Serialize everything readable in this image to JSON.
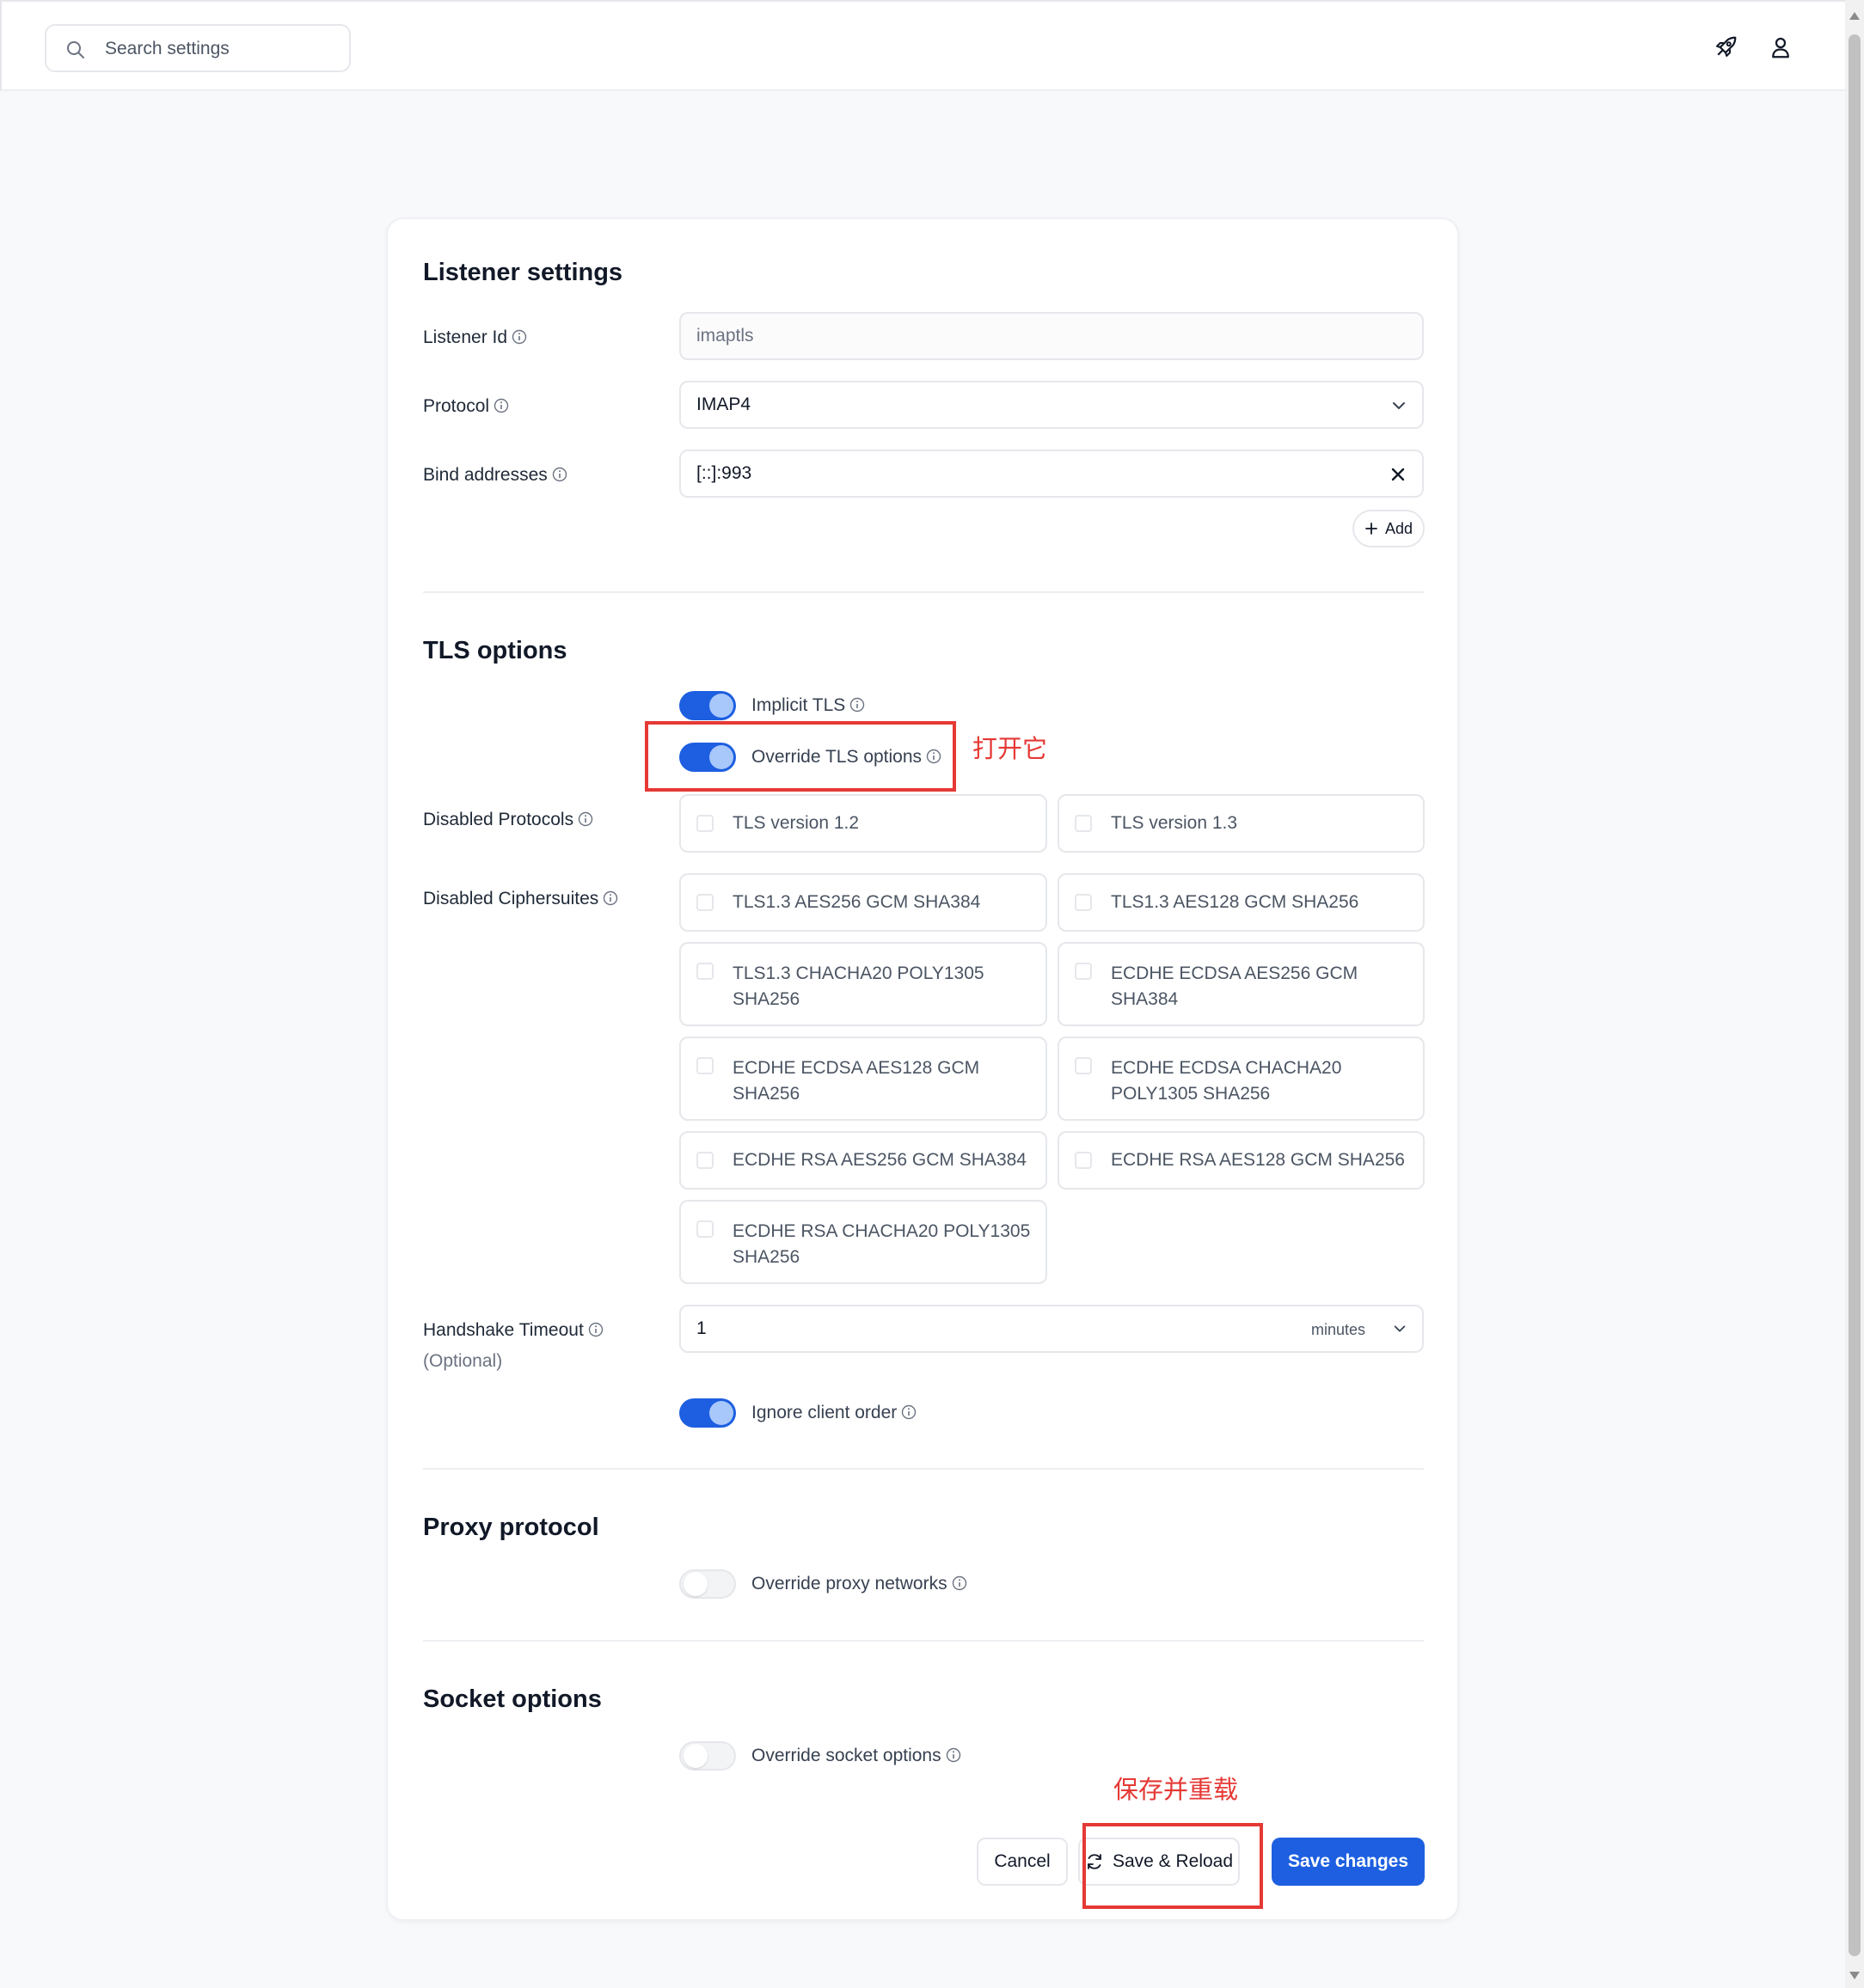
{
  "header": {
    "search_placeholder": "Search settings",
    "icons": [
      "rocket-icon",
      "user-icon"
    ]
  },
  "listener": {
    "title": "Listener settings",
    "listener_id_label": "Listener Id",
    "listener_id_value": "imaptls",
    "protocol_label": "Protocol",
    "protocol_value": "IMAP4",
    "bind_label": "Bind addresses",
    "bind_value": "[::]:993",
    "add_label": "Add"
  },
  "tls": {
    "title": "TLS options",
    "implicit_label": "Implicit TLS",
    "implicit_on": true,
    "override_label": "Override TLS options",
    "override_on": true,
    "disabled_protocols_label": "Disabled Protocols",
    "protocols": [
      "TLS version 1.2",
      "TLS version 1.3"
    ],
    "disabled_ciphers_label": "Disabled Ciphersuites",
    "ciphers": [
      "TLS1.3 AES256 GCM SHA384",
      "TLS1.3 AES128 GCM SHA256",
      "TLS1.3 CHACHA20 POLY1305 SHA256",
      "ECDHE ECDSA AES256 GCM SHA384",
      "ECDHE ECDSA AES128 GCM SHA256",
      "ECDHE ECDSA CHACHA20 POLY1305 SHA256",
      "ECDHE RSA AES256 GCM SHA384",
      "ECDHE RSA AES128 GCM SHA256",
      "ECDHE RSA CHACHA20 POLY1305 SHA256"
    ],
    "handshake_label": "Handshake Timeout",
    "handshake_optional": "(Optional)",
    "handshake_value": "1",
    "handshake_unit": "minutes",
    "ignore_order_label": "Ignore client order",
    "ignore_order_on": true
  },
  "proxy": {
    "title": "Proxy protocol",
    "override_label": "Override proxy networks",
    "override_on": false
  },
  "socket": {
    "title": "Socket options",
    "override_label": "Override socket options",
    "override_on": false
  },
  "actions": {
    "cancel": "Cancel",
    "save_reload": "Save & Reload",
    "save": "Save changes"
  },
  "annotations": {
    "turn_on": "打开它",
    "save_reload_note": "保存并重载",
    "color": "#e53935"
  }
}
